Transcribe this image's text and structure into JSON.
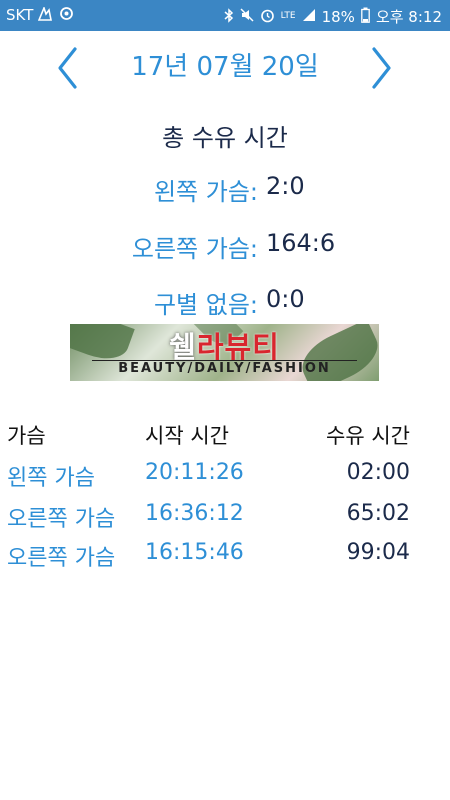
{
  "status_bar": {
    "carrier": "SKT",
    "battery": "18%",
    "time": "오후 8:12",
    "network": "LTE"
  },
  "date_nav": {
    "date": "17년 07월 20일"
  },
  "summary": {
    "title": "총 수유 시간",
    "rows": [
      {
        "label": "왼쪽 가슴:",
        "value": "2:0"
      },
      {
        "label": "오른쪽 가슴:",
        "value": "164:6"
      },
      {
        "label": "구별 없음:",
        "value": "0:0"
      }
    ]
  },
  "ad": {
    "brand_prefix": "쉘",
    "brand": "라뷰티",
    "tagline": "BEAUTY/DAILY/FASHION"
  },
  "log": {
    "headers": {
      "side": "가슴",
      "start": "시작 시간",
      "duration": "수유 시간"
    },
    "rows": [
      {
        "side": "왼쪽 가슴",
        "start": "20:11:26",
        "duration": "02:00"
      },
      {
        "side": "오른쪽 가슴",
        "start": "16:36:12",
        "duration": "65:02"
      },
      {
        "side": "오른쪽 가슴",
        "start": "16:15:46",
        "duration": "99:04"
      }
    ]
  },
  "colors": {
    "accent": "#2e8fd6",
    "status_bar": "#3b86c4",
    "dark_text": "#1b2a4a",
    "ad_red": "#d9262e"
  }
}
